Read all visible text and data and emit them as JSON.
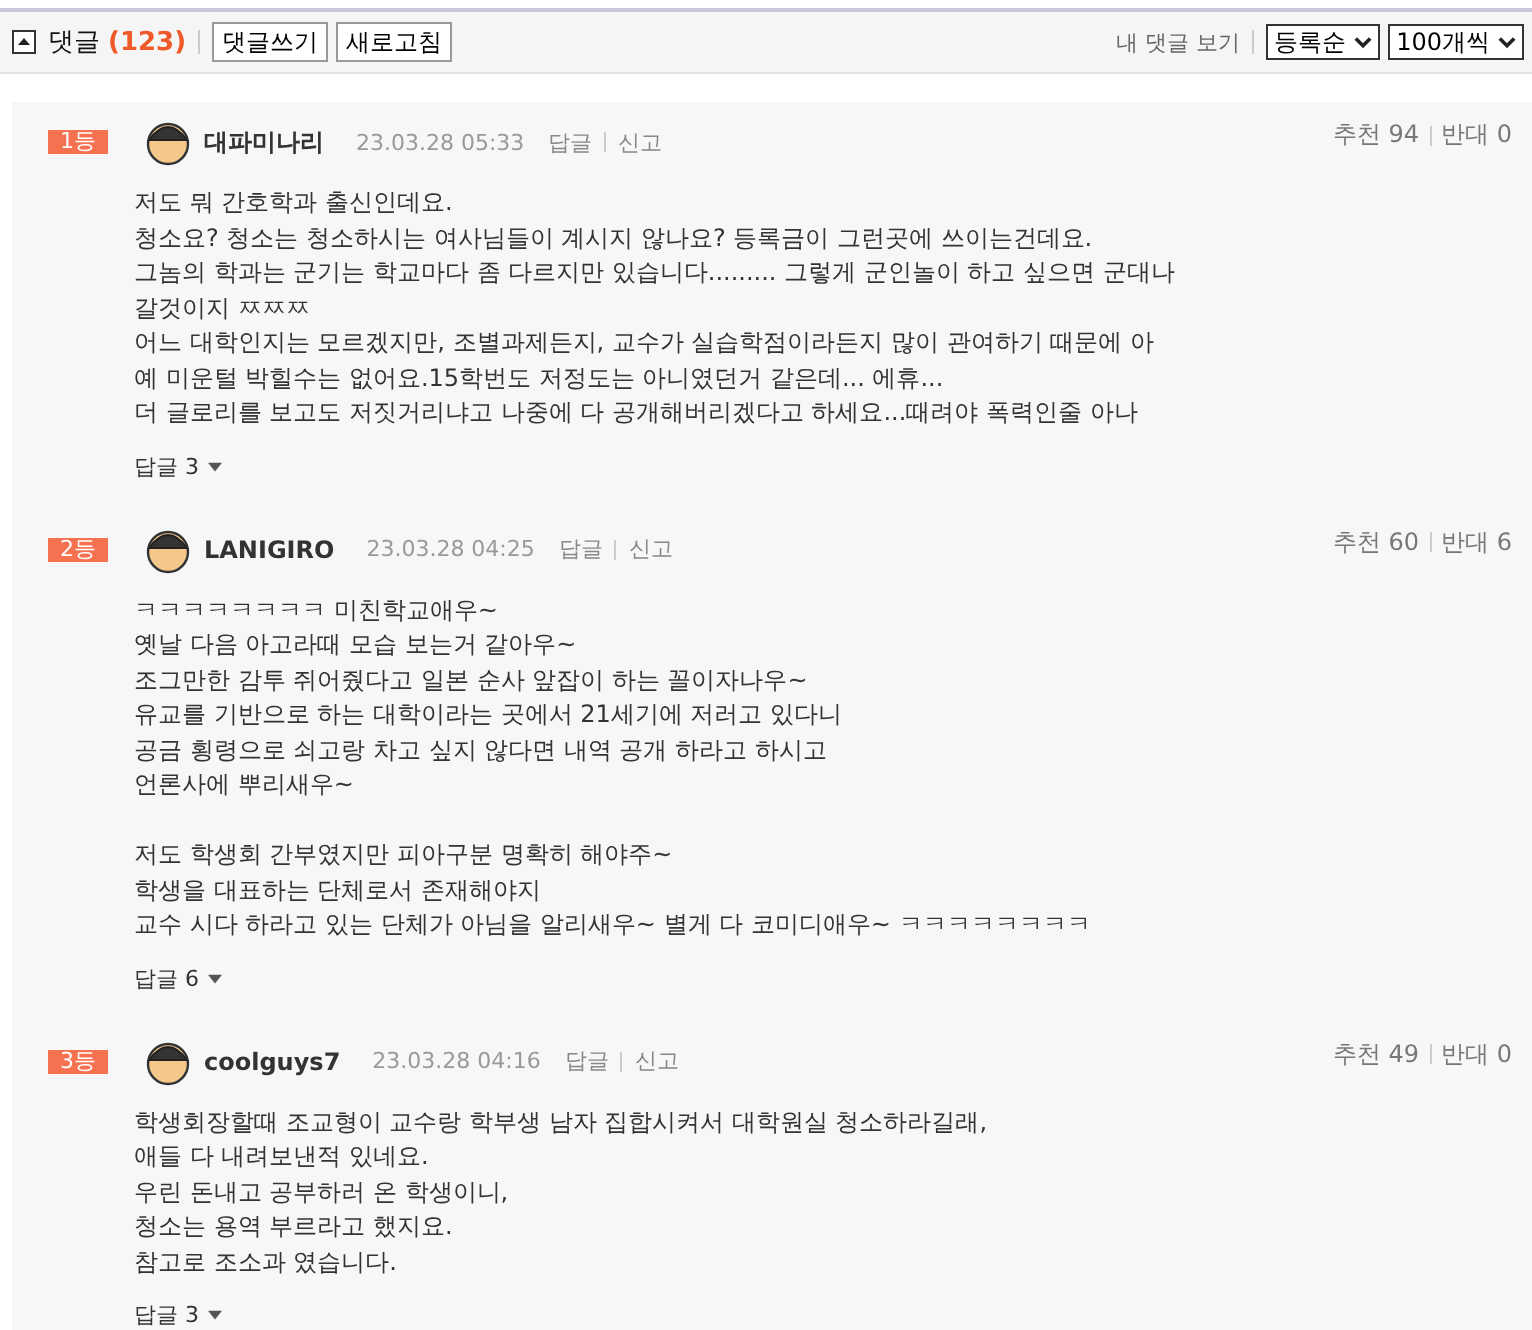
{
  "toolbar": {
    "title": "댓글",
    "count": "(123)",
    "expanded": true,
    "buttons": [
      "댓글쓰기",
      "새로고침"
    ],
    "my_comments_link": "내 댓글 보기",
    "sort_select": "등록순",
    "page_size_select": "100개씩"
  },
  "comments": [
    {
      "rank": "1등",
      "author": "대파미나리",
      "date": "23.03.28 05:33",
      "reply_link": "답글",
      "report_link": "신고",
      "likes": "추천 94",
      "dislikes": "반대 0",
      "paragraphs": [
        [
          "저도 뭐 간호학과 출신인데요.",
          "청소요? 청소는 청소하시는 여사님들이 계시지 않나요? 등록금이 그런곳에 쓰이는건데요.",
          "그놈의 학과는 군기는 학교마다 좀 다르지만 있습니다......... 그렇게 군인놀이 하고 싶으면 군대나",
          "갈것이지 ㅉㅉㅉ",
          "어느 대학인지는 모르겠지만, 조별과제든지, 교수가 실습학점이라든지 많이 관여하기 때문에 아",
          "예 미운털 박힐수는 없어요.15학번도 저정도는 아니였던거 같은데... 에휴...",
          "더 글로리를 보고도 저짓거리냐고 나중에 다 공개해버리겠다고 하세요...때려야 폭력인줄 아나"
        ]
      ],
      "replies_toggle": "답글 3"
    },
    {
      "rank": "2등",
      "author": "LANIGIRO",
      "date": "23.03.28 04:25",
      "reply_link": "답글",
      "report_link": "신고",
      "likes": "추천 60",
      "dislikes": "반대 6",
      "paragraphs": [
        [
          "ㅋㅋㅋㅋㅋㅋㅋㅋ 미친학교애우~",
          "옛날 다음 아고라때 모습 보는거 같아우~",
          "조그만한 감투 쥐어줬다고 일본 순사 앞잡이 하는 꼴이자나우~",
          "유교를 기반으로 하는 대학이라는 곳에서 21세기에 저러고 있다니",
          "공금 횡령으로 쇠고랑 차고 싶지 않다면 내역 공개 하라고 하시고",
          "언론사에 뿌리새우~"
        ],
        [
          "저도 학생회 간부였지만 피아구분 명확히 해야주~",
          "학생을 대표하는 단체로서 존재해야지",
          "교수 시다 하라고 있는 단체가 아님을 알리새우~ 별게 다 코미디애우~ ㅋㅋㅋㅋㅋㅋㅋㅋ"
        ]
      ],
      "replies_toggle": "답글 6"
    },
    {
      "rank": "3등",
      "author": "coolguys7",
      "date": "23.03.28 04:16",
      "reply_link": "답글",
      "report_link": "신고",
      "likes": "추천 49",
      "dislikes": "반대 0",
      "paragraphs": [
        [
          "학생회장할때 조교형이 교수랑 학부생 남자 집합시켜서 대학원실 청소하라길래,",
          "애들 다 내려보낸적 있네요.",
          "우린 돈내고 공부하러 온 학생이니,",
          "청소는 용역 부르라고 했지요.",
          "참고로 조소과 였습니다."
        ]
      ],
      "replies_toggle": "답글 3"
    }
  ]
}
